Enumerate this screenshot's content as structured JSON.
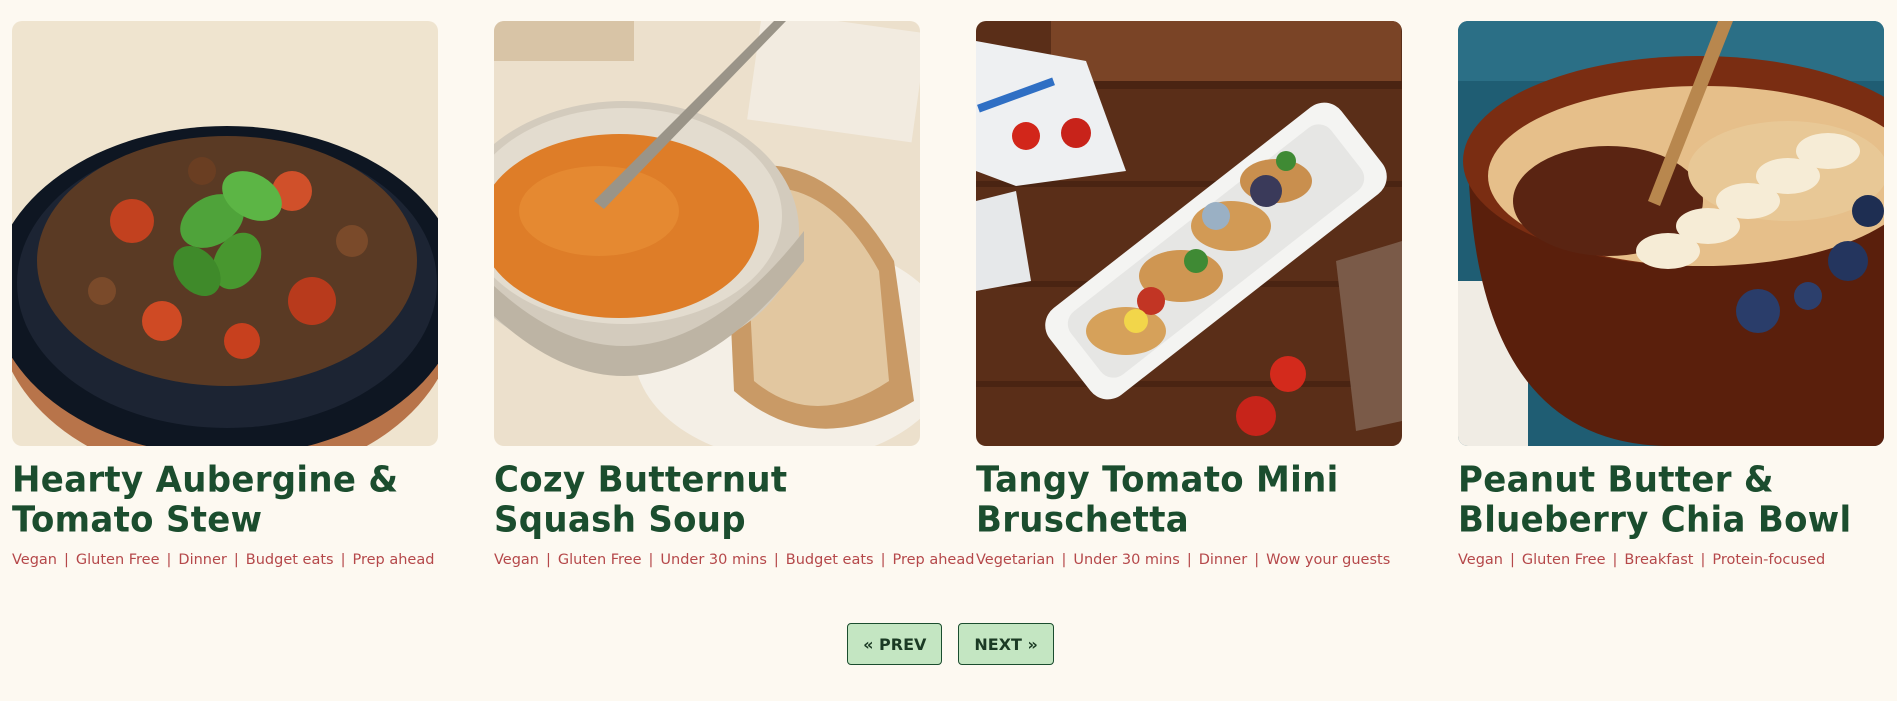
{
  "recipes": [
    {
      "title": "Hearty Aubergine & Tomato Stew",
      "image": "aubergine-stew-photo",
      "tags": [
        "Vegan",
        "Gluten Free",
        "Dinner",
        "Budget eats",
        "Prep ahead"
      ]
    },
    {
      "title": "Cozy Butternut Squash Soup",
      "image": "butternut-soup-photo",
      "tags": [
        "Vegan",
        "Gluten Free",
        "Under 30 mins",
        "Budget eats",
        "Prep ahead"
      ]
    },
    {
      "title": "Tangy Tomato Mini Bruschetta",
      "image": "bruschetta-photo",
      "tags": [
        "Vegetarian",
        "Under 30 mins",
        "Dinner",
        "Wow your guests"
      ]
    },
    {
      "title": "Peanut Butter & Blueberry Chia Bowl",
      "image": "chia-bowl-photo",
      "tags": [
        "Vegan",
        "Gluten Free",
        "Breakfast",
        "Protein-focused"
      ]
    }
  ],
  "pagination": {
    "prev_label": "« PREV",
    "next_label": "NEXT »"
  },
  "colors": {
    "background": "#fdf9f1",
    "title": "#1b4d2e",
    "tag": "#b5484a",
    "button_bg": "#c4e6c2"
  }
}
